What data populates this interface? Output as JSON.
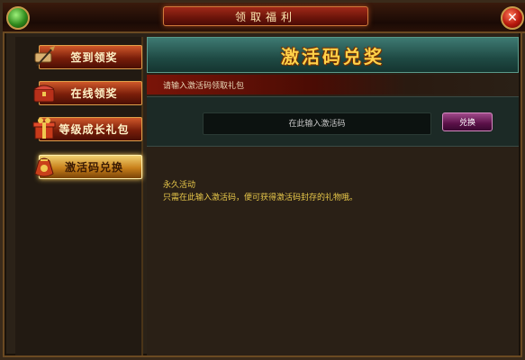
{
  "window": {
    "title": "领取福利"
  },
  "sidebar": {
    "items": [
      {
        "label": "签到领奖",
        "icon": "scroll-quill-icon",
        "active": false
      },
      {
        "label": "在线领奖",
        "icon": "treasure-chest-icon",
        "active": false
      },
      {
        "label": "等级成长礼包",
        "icon": "gift-box-icon",
        "active": false
      },
      {
        "label": "激活码兑换",
        "icon": "red-pouch-icon",
        "active": true
      }
    ]
  },
  "main": {
    "banner_title": "激活码兑奖",
    "hint": "请输入激活码领取礼包",
    "code_input": {
      "placeholder": "在此输入激活码",
      "value": ""
    },
    "redeem_label": "兑换",
    "description": {
      "title": "永久活动",
      "body": "只需在此输入激活码，便可获得激活码封存的礼物哦。"
    }
  },
  "colors": {
    "accent_red": "#7a1408",
    "accent_gold": "#ffd24a",
    "panel_teal": "#1f4a44"
  }
}
